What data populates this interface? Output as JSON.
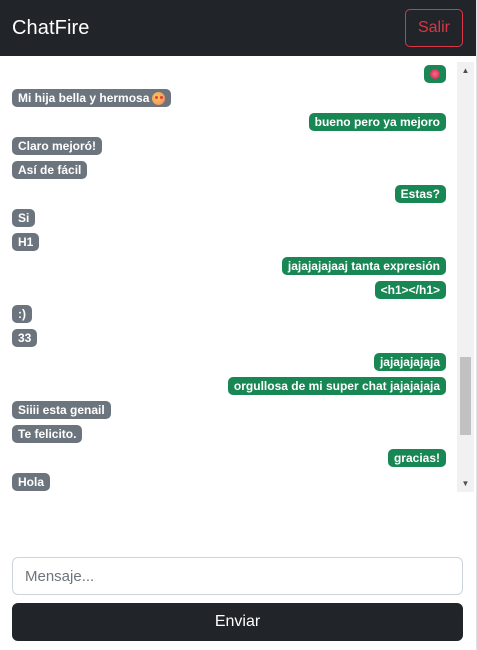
{
  "navbar": {
    "brand": "ChatFire",
    "logout_label": "Salir",
    "background": "#212529",
    "logout_color": "#dc3545"
  },
  "messages": [
    {
      "direction": "sent",
      "text": "",
      "emoji": "heart-emoji"
    },
    {
      "direction": "received",
      "text": "Mi hija bella y hermosa",
      "emoji": "heart-eyes-emoji"
    },
    {
      "direction": "sent",
      "text": "bueno pero ya mejoro"
    },
    {
      "direction": "received",
      "text": "Claro mejoró!"
    },
    {
      "direction": "received",
      "text": "Así de fácil"
    },
    {
      "direction": "sent",
      "text": "Estas?"
    },
    {
      "direction": "received",
      "text": "Si"
    },
    {
      "direction": "received",
      "text": "H1"
    },
    {
      "direction": "sent",
      "text": "jajajajajaaj tanta expresión"
    },
    {
      "direction": "sent",
      "text": "<h1></h1>"
    },
    {
      "direction": "received",
      "text": ":)"
    },
    {
      "direction": "received",
      "text": "33"
    },
    {
      "direction": "sent",
      "text": "jajajajajaja"
    },
    {
      "direction": "sent",
      "text": "orgullosa de mi super chat jajajajaja"
    },
    {
      "direction": "received",
      "text": "Siiii esta genail"
    },
    {
      "direction": "received",
      "text": "Te felicito."
    },
    {
      "direction": "sent",
      "text": "gracias!"
    },
    {
      "direction": "received",
      "text": "Hola"
    }
  ],
  "bubble_colors": {
    "sent": "#198754",
    "received": "#6c757d"
  },
  "composer": {
    "placeholder": "Mensaje...",
    "value": "",
    "send_label": "Enviar"
  }
}
